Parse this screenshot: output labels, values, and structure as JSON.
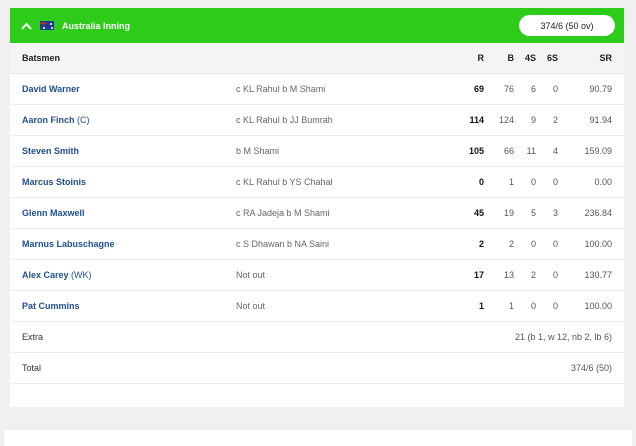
{
  "header": {
    "title": "Australia Inning",
    "score": "374/6 (50 ov)",
    "colors": {
      "bar": "#2ecc1a",
      "name_link": "#1f4f8f"
    },
    "icons": {
      "collapse": "chevron-up-icon",
      "flag": "australia-flag-icon"
    }
  },
  "columns": {
    "batsmen": "Batsmen",
    "r": "R",
    "b": "B",
    "fours": "4S",
    "sixes": "6S",
    "sr": "SR"
  },
  "batsmen": [
    {
      "name": "David Warner",
      "tag": "",
      "dismissal": "c KL Rahul b M Shami",
      "r": "69",
      "b": "76",
      "fours": "6",
      "sixes": "0",
      "sr": "90.79"
    },
    {
      "name": "Aaron Finch",
      "tag": "(C)",
      "dismissal": "c KL Rahul b JJ Bumrah",
      "r": "114",
      "b": "124",
      "fours": "9",
      "sixes": "2",
      "sr": "91.94"
    },
    {
      "name": "Steven Smith",
      "tag": "",
      "dismissal": "b M Shami",
      "r": "105",
      "b": "66",
      "fours": "11",
      "sixes": "4",
      "sr": "159.09"
    },
    {
      "name": "Marcus Stoinis",
      "tag": "",
      "dismissal": "c KL Rahul b YS Chahal",
      "r": "0",
      "b": "1",
      "fours": "0",
      "sixes": "0",
      "sr": "0.00"
    },
    {
      "name": "Glenn Maxwell",
      "tag": "",
      "dismissal": "c RA Jadeja b M Shami",
      "r": "45",
      "b": "19",
      "fours": "5",
      "sixes": "3",
      "sr": "236.84"
    },
    {
      "name": "Marnus Labuschagne",
      "tag": "",
      "dismissal": "c S Dhawan b NA Saini",
      "r": "2",
      "b": "2",
      "fours": "0",
      "sixes": "0",
      "sr": "100.00"
    },
    {
      "name": "Alex Carey",
      "tag": "(WK)",
      "dismissal": "Not out",
      "r": "17",
      "b": "13",
      "fours": "2",
      "sixes": "0",
      "sr": "130.77"
    },
    {
      "name": "Pat Cummins",
      "tag": "",
      "dismissal": "Not out",
      "r": "1",
      "b": "1",
      "fours": "0",
      "sixes": "0",
      "sr": "100.00"
    }
  ],
  "extra": {
    "label": "Extra",
    "value": "21 (b 1, w 12, nb 2, lb 6)"
  },
  "total": {
    "label": "Total",
    "value": "374/6 (50)"
  }
}
